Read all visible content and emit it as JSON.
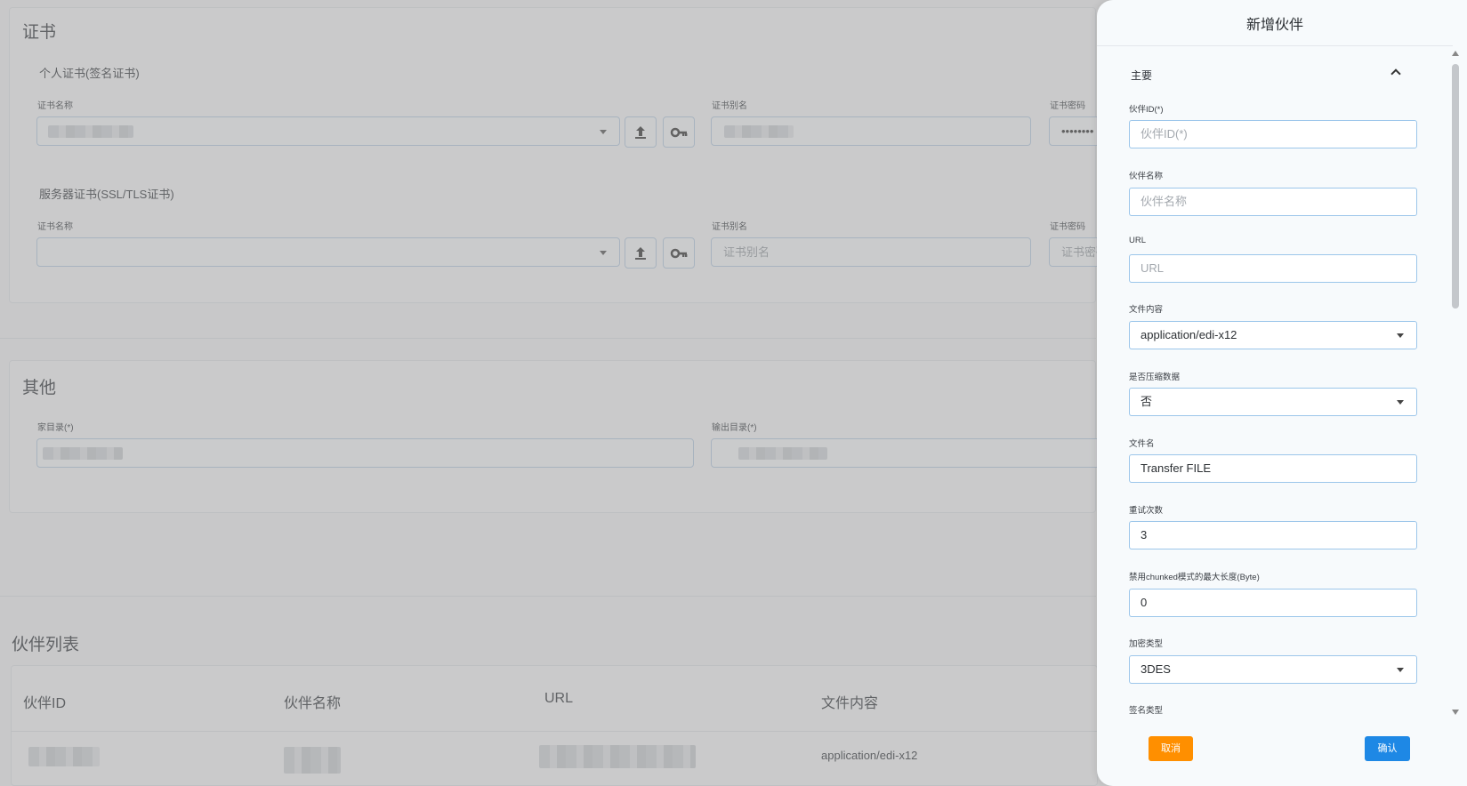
{
  "certificates": {
    "title": "证书",
    "personal": {
      "title": "个人证书(签名证书)",
      "name_label": "证书名称",
      "alias_label": "证书别名",
      "password_label": "证书密码",
      "password_value": "••••••••"
    },
    "server": {
      "title": "服务器证书(SSL/TLS证书)",
      "name_label": "证书名称",
      "alias_label": "证书别名",
      "alias_placeholder": "证书别名",
      "password_label": "证书密码",
      "password_placeholder": "证书密码"
    }
  },
  "other": {
    "title": "其他",
    "home_dir_label": "家目录(*)",
    "output_dir_label": "输出目录(*)"
  },
  "partner_list": {
    "title": "伙伴列表",
    "columns": [
      "伙伴ID",
      "伙伴名称",
      "URL",
      "文件内容"
    ],
    "rows": [
      {
        "file_content": "application/edi-x12"
      }
    ]
  },
  "drawer": {
    "title": "新增伙伴",
    "section": "主要",
    "fields": {
      "partner_id": {
        "label": "伙伴ID(*)",
        "placeholder": "伙伴ID(*)"
      },
      "partner_name": {
        "label": "伙伴名称",
        "placeholder": "伙伴名称"
      },
      "url": {
        "label": "URL",
        "placeholder": "URL"
      },
      "file_content": {
        "label": "文件内容",
        "value": "application/edi-x12"
      },
      "compress": {
        "label": "是否压缩数据",
        "value": "否"
      },
      "file_name": {
        "label": "文件名",
        "value": "Transfer FILE"
      },
      "retry": {
        "label": "重试次数",
        "value": "3"
      },
      "chunked_max": {
        "label": "禁用chunked模式的最大长度(Byte)",
        "value": "0"
      },
      "encryption": {
        "label": "加密类型",
        "value": "3DES"
      },
      "signature": {
        "label": "签名类型"
      }
    },
    "cancel_label": "取消",
    "confirm_label": "确认"
  },
  "colors": {
    "cancel": "#ff8f00",
    "confirm": "#1e88e5",
    "input_border": "#9cc6ea"
  }
}
